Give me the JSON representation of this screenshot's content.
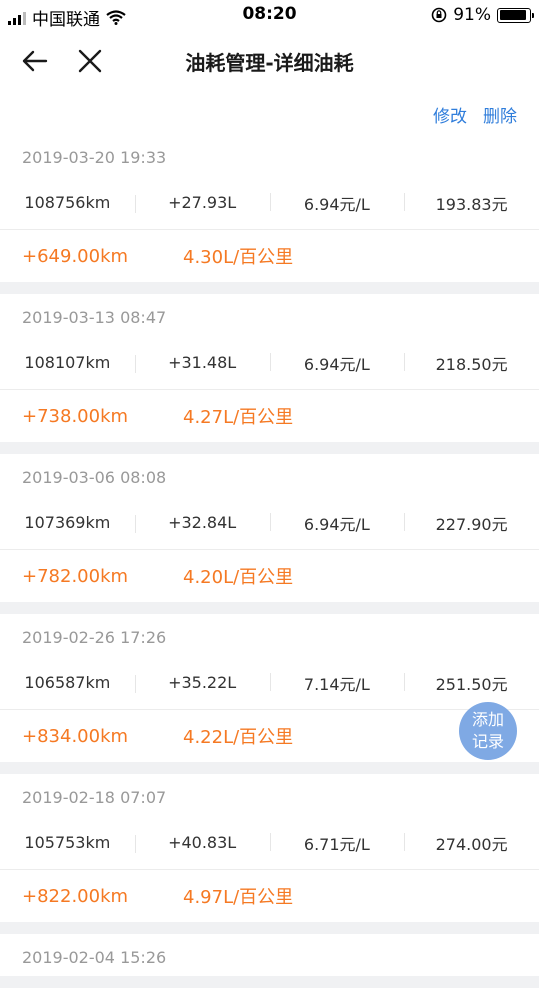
{
  "status_bar": {
    "carrier": "中国联通",
    "time": "08:20",
    "battery": "91%"
  },
  "header": {
    "title": "油耗管理-详细油耗",
    "back_icon": "arrow-left-icon",
    "close_icon": "close-icon"
  },
  "actions": {
    "edit": "修改",
    "delete": "删除"
  },
  "records": [
    {
      "datetime": "2019-03-20 19:33",
      "odometer": "108756km",
      "fuel": "+27.93L",
      "price": "6.94元/L",
      "cost": "193.83元",
      "distance": "+649.00km",
      "consumption": "4.30L/百公里"
    },
    {
      "datetime": "2019-03-13 08:47",
      "odometer": "108107km",
      "fuel": "+31.48L",
      "price": "6.94元/L",
      "cost": "218.50元",
      "distance": "+738.00km",
      "consumption": "4.27L/百公里"
    },
    {
      "datetime": "2019-03-06 08:08",
      "odometer": "107369km",
      "fuel": "+32.84L",
      "price": "6.94元/L",
      "cost": "227.90元",
      "distance": "+782.00km",
      "consumption": "4.20L/百公里"
    },
    {
      "datetime": "2019-02-26 17:26",
      "odometer": "106587km",
      "fuel": "+35.22L",
      "price": "7.14元/L",
      "cost": "251.50元",
      "distance": "+834.00km",
      "consumption": "4.22L/百公里"
    },
    {
      "datetime": "2019-02-18 07:07",
      "odometer": "105753km",
      "fuel": "+40.83L",
      "price": "6.71元/L",
      "cost": "274.00元",
      "distance": "+822.00km",
      "consumption": "4.97L/百公里"
    },
    {
      "datetime": "2019-02-04 15:26",
      "odometer": "",
      "fuel": "",
      "price": "",
      "cost": "",
      "distance": "",
      "consumption": ""
    }
  ],
  "fab": {
    "line1": "添加",
    "line2": "记录"
  },
  "colors": {
    "accent_blue": "#2f7ddb",
    "accent_orange": "#f57923",
    "fab": "#7fa9e4"
  }
}
